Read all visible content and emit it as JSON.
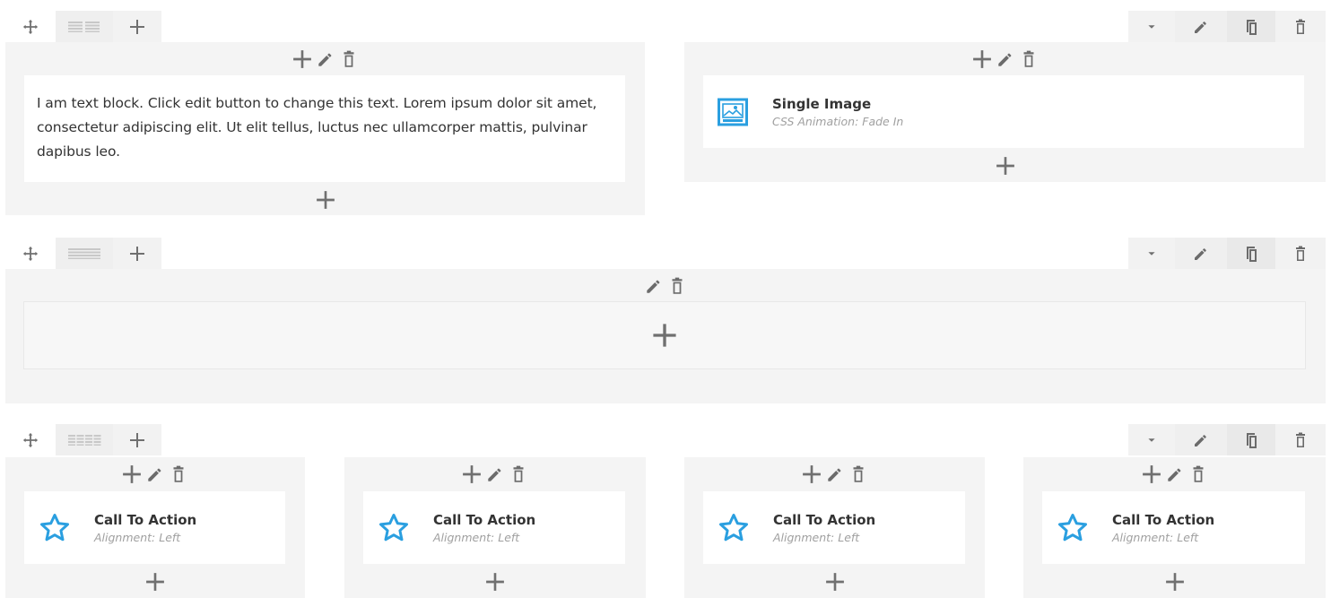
{
  "rows": [
    {
      "columns": [
        {
          "element": {
            "type": "text",
            "text": "I am text block. Click edit button to change this text. Lorem ipsum dolor sit amet, consectetur adipiscing elit. Ut elit tellus, luctus nec ullamcorper mattis, pulvinar dapibus leo."
          }
        },
        {
          "element": {
            "type": "single-image",
            "title": "Single Image",
            "subtitle": "CSS Animation: Fade In"
          }
        }
      ]
    },
    {
      "columns": [
        {
          "element": null
        }
      ]
    },
    {
      "columns": [
        {
          "element": {
            "type": "call-to-action",
            "title": "Call To Action",
            "subtitle": "Alignment: Left"
          }
        },
        {
          "element": {
            "type": "call-to-action",
            "title": "Call To Action",
            "subtitle": "Alignment: Left"
          }
        },
        {
          "element": {
            "type": "call-to-action",
            "title": "Call To Action",
            "subtitle": "Alignment: Left"
          }
        },
        {
          "element": {
            "type": "call-to-action",
            "title": "Call To Action",
            "subtitle": "Alignment: Left"
          }
        }
      ]
    }
  ],
  "icons": {
    "move": "move-icon",
    "layout": "layout-icon",
    "add": "plus-icon",
    "toggle": "caret-down-icon",
    "edit": "pencil-icon",
    "copy": "copy-icon",
    "delete": "trash-icon",
    "image": "image-icon",
    "star": "star-icon"
  },
  "colors": {
    "icon": "#6b6b6b",
    "accent": "#2a9fe0",
    "column_bg": "#f4f4f4"
  }
}
